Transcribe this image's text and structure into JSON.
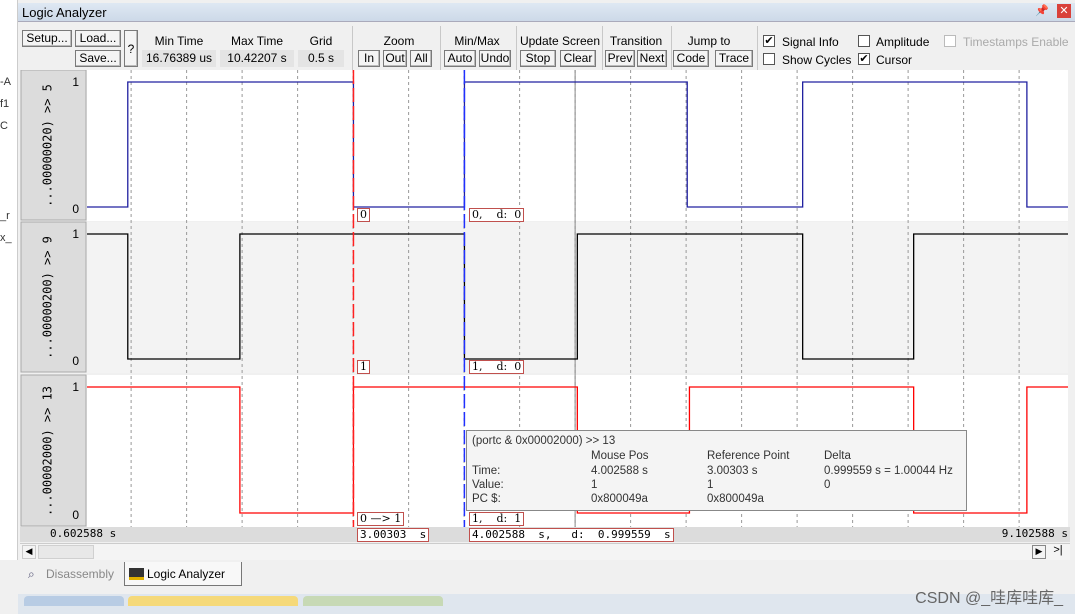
{
  "left_strip": {
    "lines": [
      "-A",
      "f1",
      "C",
      "_r",
      "x_"
    ]
  },
  "window": {
    "title": "Logic Analyzer"
  },
  "toolbar": {
    "setup": "Setup...",
    "load": "Load...",
    "save": "Save...",
    "help": "?",
    "min_time_label": "Min Time",
    "min_time": "16.76389 us",
    "max_time_label": "Max Time",
    "max_time": "10.42207 s",
    "grid_label": "Grid",
    "grid": "0.5 s",
    "zoom_label": "Zoom",
    "zoom_in": "In",
    "zoom_out": "Out",
    "zoom_all": "All",
    "minmax_label": "Min/Max",
    "auto": "Auto",
    "undo": "Undo",
    "update_label": "Update Screen",
    "stop": "Stop",
    "clear": "Clear",
    "transition_label": "Transition",
    "prev": "Prev",
    "next": "Next",
    "jump_label": "Jump to",
    "code": "Code",
    "trace": "Trace",
    "signal_info": {
      "label": "Signal Info",
      "checked": true
    },
    "amplitude": {
      "label": "Amplitude",
      "checked": false
    },
    "timestamps": {
      "label": "Timestamps Enable",
      "checked": false,
      "disabled": true
    },
    "show_cycles": {
      "label": "Show Cycles",
      "checked": false
    },
    "cursor": {
      "label": "Cursor",
      "checked": true
    }
  },
  "chart_data": {
    "type": "line",
    "xlim": [
      0.602588,
      9.43
    ],
    "grid_step": 0.5,
    "x_start_label": "0.602588  s",
    "x_end_label": "9.102588  s",
    "signals": [
      {
        "name": "...00000020) >> 5",
        "color": "#2020a0",
        "initial": 0,
        "transitions": [
          0.97,
          3.003,
          4.003,
          6.01,
          7.05,
          9.07
        ],
        "hi": "1",
        "lo": "0"
      },
      {
        "name": "...00000200) >> 9",
        "color": "#000000",
        "initial": 1,
        "transitions": [
          0.97,
          1.98,
          4.003,
          5.02,
          7.05,
          8.05
        ],
        "hi": "1",
        "lo": "0"
      },
      {
        "name": "...00002000) >> 13",
        "color": "#ff0000",
        "initial": 1,
        "transitions": [
          1.98,
          3.003,
          5.02,
          6.03,
          8.05,
          9.07
        ],
        "hi": "1",
        "lo": "0"
      }
    ],
    "ref_cursor": {
      "time": 3.00303,
      "label": "3.00303  s",
      "values": [
        "0",
        "1",
        "0 —> 1"
      ]
    },
    "mouse_cursor": {
      "time": 4.002588,
      "label": "4.002588  s,   d:  0.999559  s",
      "values": [
        "0,    d:  0",
        "1,    d:  0",
        "1,    d:  1"
      ]
    },
    "grey_line": 5.0
  },
  "tooltip": {
    "title": "(portc & 0x00002000) >> 13",
    "col_mouse": "Mouse Pos",
    "col_ref": "Reference Point",
    "col_delta": "Delta",
    "row_time": "Time:",
    "row_value": "Value:",
    "row_pc": "PC $:",
    "time_mouse": "4.002588 s",
    "time_ref": "3.00303 s",
    "time_delta": "0.999559 s = 1.00044 Hz",
    "value_mouse": "1",
    "value_ref": "1",
    "value_delta": "0",
    "pc_mouse": "0x800049a",
    "pc_ref": "0x800049a"
  },
  "tabs": [
    {
      "label": "Disassembly",
      "active": false
    },
    {
      "label": "Logic Analyzer",
      "active": true
    }
  ],
  "watermark": "CSDN @_哇库哇库_"
}
